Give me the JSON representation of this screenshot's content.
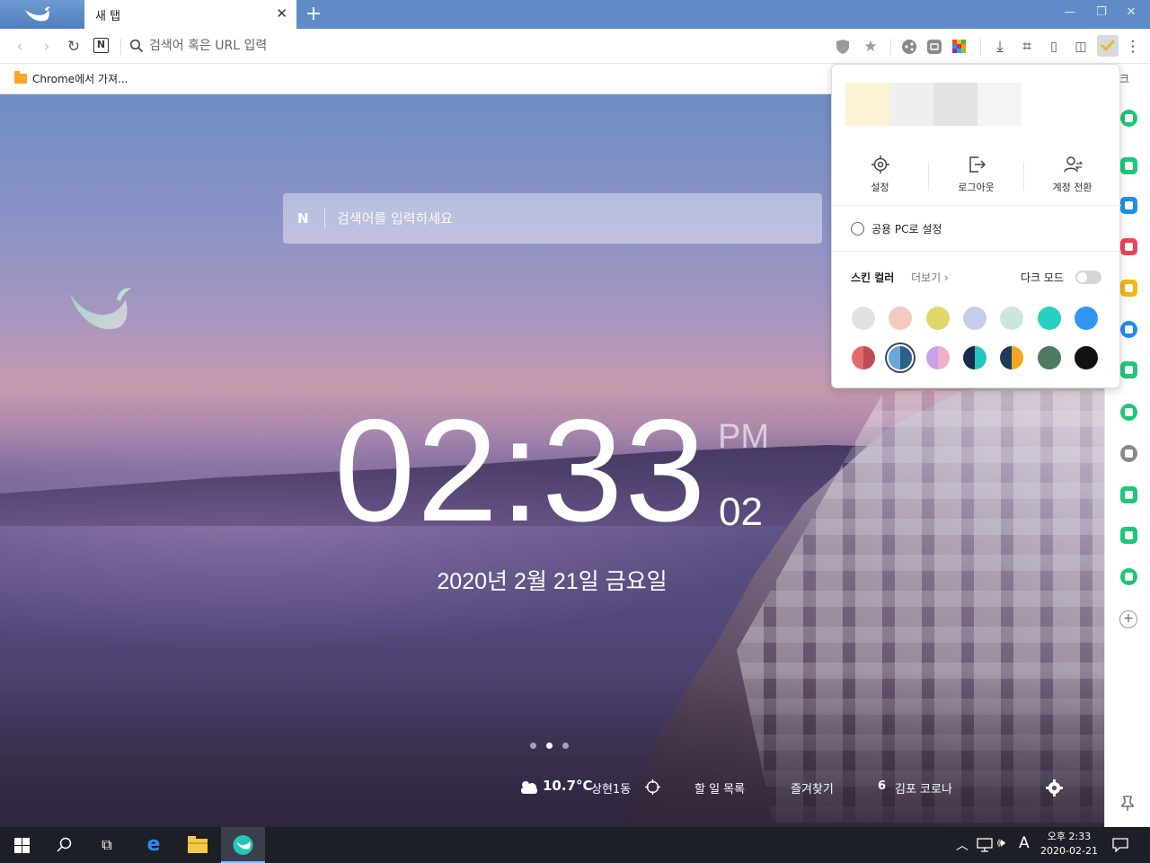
{
  "browser": {
    "tab_title": "새 탭",
    "tab_close": "✕",
    "new_tab": "+",
    "window_controls": {
      "minimize": "—",
      "restore": "❐",
      "close": "✕"
    },
    "address_placeholder": "검색어 혹은 URL 입력",
    "naver_badge": "N"
  },
  "bookmarks": {
    "items": [
      {
        "label": "Chrome에서 가져..."
      }
    ]
  },
  "newtab": {
    "search_badge": "N",
    "search_placeholder": "검색어를 입력하세요",
    "clock": {
      "time": "02:33",
      "ampm": "PM",
      "seconds": "02"
    },
    "date": "2020년 2월 21일 금요일",
    "page_dots": {
      "count": 3,
      "active_index": 1
    },
    "weather": {
      "temp": "10.7°C",
      "location": "상현1동"
    },
    "bottom_links": {
      "todo": "할 일 목록",
      "favorites": "즐겨찾기",
      "news_count": "6",
      "news_text": "김포 코로나"
    }
  },
  "profile_popup": {
    "skin_preview_colors": [
      "#fdf2d3",
      "#efefef",
      "#e3e3e3",
      "#f4f4f4"
    ],
    "actions": [
      {
        "icon": "gear-icon",
        "label": "설정"
      },
      {
        "icon": "logout-icon",
        "label": "로그아웃"
      },
      {
        "icon": "switch-account-icon",
        "label": "계정 전환"
      }
    ],
    "public_pc_label": "공용 PC로 설정",
    "skin_color_label": "스킨 컬러",
    "more_label": "더보기 ›",
    "dark_mode_label": "다크 모드",
    "dark_mode_on": false,
    "swatches_row1": [
      "#dfe1e6",
      "#f5c8c0",
      "#e1d66a",
      "#c5cfea",
      "#cce6da",
      "#27cfc2",
      "#2f96f3"
    ],
    "swatches_row2": [
      {
        "left": "#e36a6a",
        "right": "#c04a55"
      },
      {
        "left": "#6aa6d8",
        "right": "#2e5f86",
        "selected": true
      },
      {
        "left": "#c7a2ea",
        "right": "#f2aeca"
      },
      {
        "left": "#1a2a4a",
        "right": "#22c7bb"
      },
      {
        "left": "#1c3a5c",
        "right": "#f2a51e"
      },
      {
        "left": "#4e7a62",
        "right": "#4e7a62"
      },
      {
        "left": "#111111",
        "right": "#111111"
      }
    ]
  },
  "sidebar_colors": [
    "#1ec77a",
    "#1ec77a",
    "#1e8ef2",
    "#f0435a",
    "#f5b50e",
    "#1e8ef2",
    "#1ec77a",
    "#1ec77a",
    "#888888",
    "#1ec77a",
    "#1ec77a",
    "#1ec77a"
  ],
  "sidebar_add": "+",
  "taskbar": {
    "ime": "A",
    "time": "오후 2:33",
    "date": "2020-02-21"
  }
}
